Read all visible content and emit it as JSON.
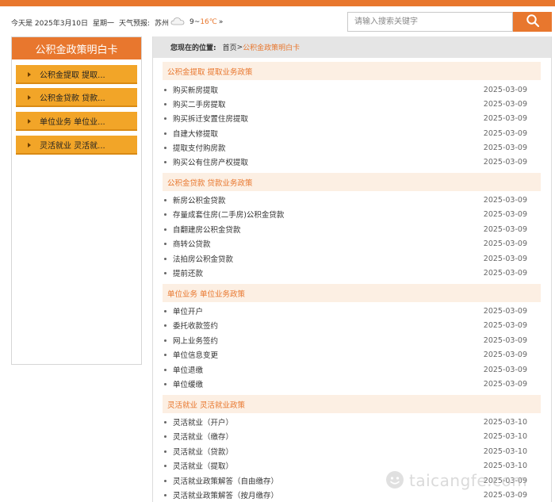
{
  "info": {
    "date": "今天是 2025年3月10日",
    "weekday": "星期一",
    "weather_label": "天气预报:",
    "city": "苏州",
    "temp_low": "9~",
    "temp_high": "16℃",
    "more": "»"
  },
  "search": {
    "placeholder": "请输入搜索关键字"
  },
  "sidebar": {
    "title": "公积金政策明白卡",
    "items": [
      {
        "label": "公积金提取 提取..."
      },
      {
        "label": "公积金贷款 贷款..."
      },
      {
        "label": "单位业务 单位业..."
      },
      {
        "label": "灵活就业 灵活就..."
      }
    ]
  },
  "breadcrumb": {
    "label": "您现在的位置:",
    "home": "首页",
    "sep": ">",
    "current": "公积金政策明白卡"
  },
  "sections": [
    {
      "title": "公积金提取 提取业务政策",
      "items": [
        {
          "title": "购买新房提取",
          "date": "2025-03-09"
        },
        {
          "title": "购买二手房提取",
          "date": "2025-03-09"
        },
        {
          "title": "购买拆迁安置住房提取",
          "date": "2025-03-09"
        },
        {
          "title": "自建大修提取",
          "date": "2025-03-09"
        },
        {
          "title": "提取支付购房款",
          "date": "2025-03-09"
        },
        {
          "title": "购买公有住房产权提取",
          "date": "2025-03-09"
        }
      ]
    },
    {
      "title": "公积金贷款 贷款业务政策",
      "items": [
        {
          "title": "新房公积金贷款",
          "date": "2025-03-09"
        },
        {
          "title": "存量成套住房(二手房)公积金贷款",
          "date": "2025-03-09"
        },
        {
          "title": "自翻建房公积金贷款",
          "date": "2025-03-09"
        },
        {
          "title": "商转公贷款",
          "date": "2025-03-09"
        },
        {
          "title": "法拍房公积金贷款",
          "date": "2025-03-09"
        },
        {
          "title": "提前还款",
          "date": "2025-03-09"
        }
      ]
    },
    {
      "title": "单位业务 单位业务政策",
      "items": [
        {
          "title": "单位开户",
          "date": "2025-03-09"
        },
        {
          "title": "委托收款签约",
          "date": "2025-03-09"
        },
        {
          "title": "网上业务签约",
          "date": "2025-03-09"
        },
        {
          "title": "单位信息变更",
          "date": "2025-03-09"
        },
        {
          "title": "单位退缴",
          "date": "2025-03-09"
        },
        {
          "title": "单位缓缴",
          "date": "2025-03-09"
        }
      ]
    },
    {
      "title": "灵活就业 灵活就业政策",
      "items": [
        {
          "title": "灵活就业（开户）",
          "date": "2025-03-10"
        },
        {
          "title": "灵活就业（缴存）",
          "date": "2025-03-10"
        },
        {
          "title": "灵活就业（贷款）",
          "date": "2025-03-10"
        },
        {
          "title": "灵活就业（提取）",
          "date": "2025-03-10"
        },
        {
          "title": "灵活就业政策解答（自由缴存）",
          "date": "2025-03-09"
        },
        {
          "title": "灵活就业政策解答（按月缴存）",
          "date": "2025-03-09"
        }
      ]
    }
  ],
  "watermark": "taicangfe.com",
  "colors": {
    "accent": "#e8772e",
    "sidebar_item": "#f2a528",
    "section_bg": "#fcefe3"
  }
}
